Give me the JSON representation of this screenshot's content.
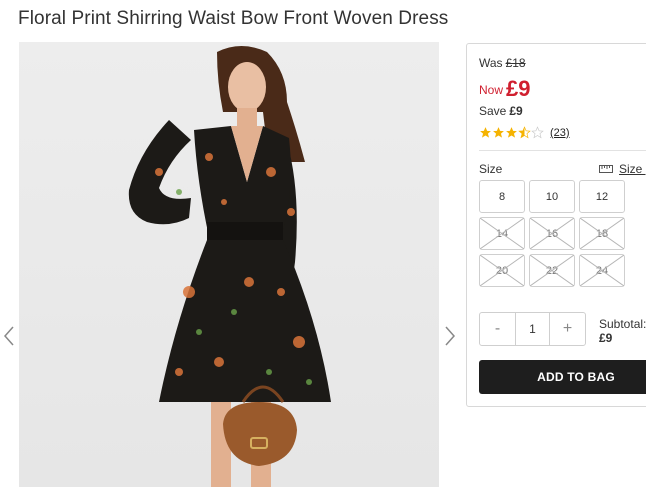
{
  "product": {
    "title": "Floral Print Shirring Waist Bow Front Woven Dress"
  },
  "gallery": {
    "prev_icon": "chevron-left-icon",
    "next_icon": "chevron-right-icon"
  },
  "price": {
    "was_label": "Was",
    "was_value": "£18",
    "now_label": "Now",
    "now_value": "£9",
    "save_label": "Save",
    "save_value": "£9"
  },
  "rating": {
    "stars": 3.5,
    "max": 5,
    "reviews": "(23)",
    "star_color": "#f5b301"
  },
  "size": {
    "label": "Size",
    "guide_label": "Size g",
    "guide_icon": "ruler-icon",
    "options": [
      {
        "label": "8",
        "available": true
      },
      {
        "label": "10",
        "available": true
      },
      {
        "label": "12",
        "available": true
      },
      {
        "label": "14",
        "available": false
      },
      {
        "label": "16",
        "available": false
      },
      {
        "label": "18",
        "available": false
      },
      {
        "label": "20",
        "available": false
      },
      {
        "label": "22",
        "available": false
      },
      {
        "label": "24",
        "available": false
      }
    ]
  },
  "quantity": {
    "minus": "-",
    "value": "1",
    "plus": "+"
  },
  "subtotal": {
    "label": "Subtotal:",
    "value": "£9"
  },
  "actions": {
    "add_to_bag": "ADD TO BAG"
  },
  "colors": {
    "accent_price": "#d01f2f",
    "button_bg": "#1e1e1e"
  }
}
